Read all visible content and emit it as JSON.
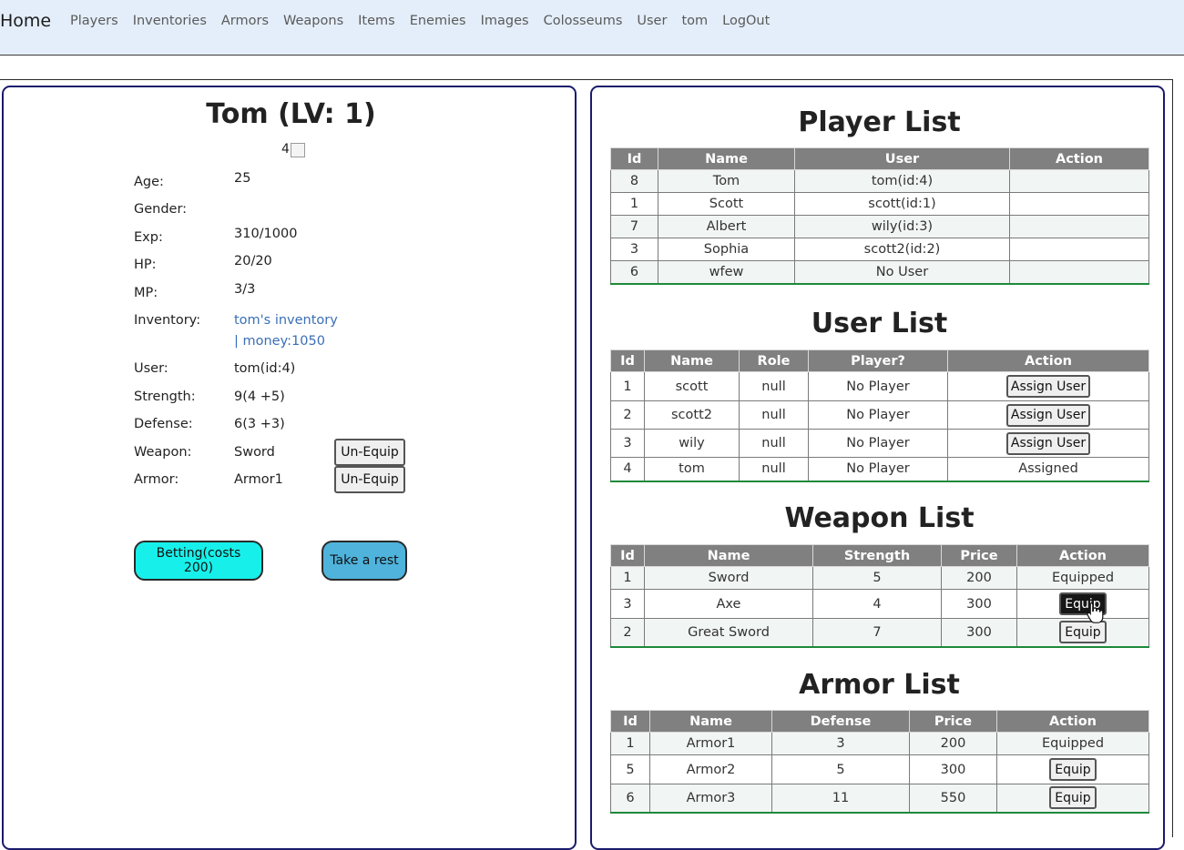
{
  "nav": {
    "brand": "Home",
    "links": [
      "Players",
      "Inventories",
      "Armors",
      "Weapons",
      "Items",
      "Enemies",
      "Images",
      "Colosseums",
      "User",
      "tom",
      "LogOut"
    ]
  },
  "player": {
    "title": "Tom (LV: 1)",
    "image_alt": "4",
    "stats": [
      {
        "label": "Age:",
        "value": "25"
      },
      {
        "label": "Gender:",
        "value": ""
      },
      {
        "label": "Exp:",
        "value": "310/1000"
      },
      {
        "label": "HP:",
        "value": "20/20"
      },
      {
        "label": "MP:",
        "value": "3/3"
      },
      {
        "label": "Inventory:",
        "value": "tom's inventory",
        "value2": "| money:1050"
      },
      {
        "label": "User:",
        "value": "tom(id:4)"
      },
      {
        "label": "Strength:",
        "value": "9(4 +5)"
      },
      {
        "label": "Defense:",
        "value": "6(3 +3)"
      },
      {
        "label": "Weapon:",
        "value": "Sword",
        "button": "Un-Equip"
      },
      {
        "label": "Armor:",
        "value": "Armor1",
        "button": "Un-Equip"
      }
    ],
    "bet_button": "Betting(costs 200)",
    "rest_button": "Take a rest"
  },
  "player_list": {
    "title": "Player List",
    "headers": [
      "Id",
      "Name",
      "User",
      "Action"
    ],
    "rows": [
      [
        "8",
        "Tom",
        "tom(id:4)",
        ""
      ],
      [
        "1",
        "Scott",
        "scott(id:1)",
        ""
      ],
      [
        "7",
        "Albert",
        "wily(id:3)",
        ""
      ],
      [
        "3",
        "Sophia",
        "scott2(id:2)",
        ""
      ],
      [
        "6",
        "wfew",
        "No User",
        ""
      ]
    ]
  },
  "user_list": {
    "title": "User List",
    "headers": [
      "Id",
      "Name",
      "Role",
      "Player?",
      "Action"
    ],
    "rows": [
      [
        "1",
        "scott",
        "null",
        "No Player",
        "Assign User"
      ],
      [
        "2",
        "scott2",
        "null",
        "No Player",
        "Assign User"
      ],
      [
        "3",
        "wily",
        "null",
        "No Player",
        "Assign User"
      ],
      [
        "4",
        "tom",
        "null",
        "No Player",
        "Assigned"
      ]
    ]
  },
  "weapon_list": {
    "title": "Weapon List",
    "headers": [
      "Id",
      "Name",
      "Strength",
      "Price",
      "Action"
    ],
    "rows": [
      [
        "1",
        "Sword",
        "5",
        "200",
        "Equipped"
      ],
      [
        "3",
        "Axe",
        "4",
        "300",
        "Equip"
      ],
      [
        "2",
        "Great Sword",
        "7",
        "300",
        "Equip"
      ]
    ]
  },
  "armor_list": {
    "title": "Armor List",
    "headers": [
      "Id",
      "Name",
      "Defense",
      "Price",
      "Action"
    ],
    "rows": [
      [
        "1",
        "Armor1",
        "3",
        "200",
        "Equipped"
      ],
      [
        "5",
        "Armor2",
        "5",
        "300",
        "Equip"
      ],
      [
        "6",
        "Armor3",
        "11",
        "550",
        "Equip"
      ]
    ]
  },
  "colors": {
    "navbar_bg": "#e4eefa",
    "panel_border": "#1a1a6e",
    "table_header": "#808080",
    "table_bottom": "#1e8a3a",
    "bet_button": "#17f0ea",
    "rest_button": "#4fb3dc",
    "link": "#3a6fb6"
  }
}
